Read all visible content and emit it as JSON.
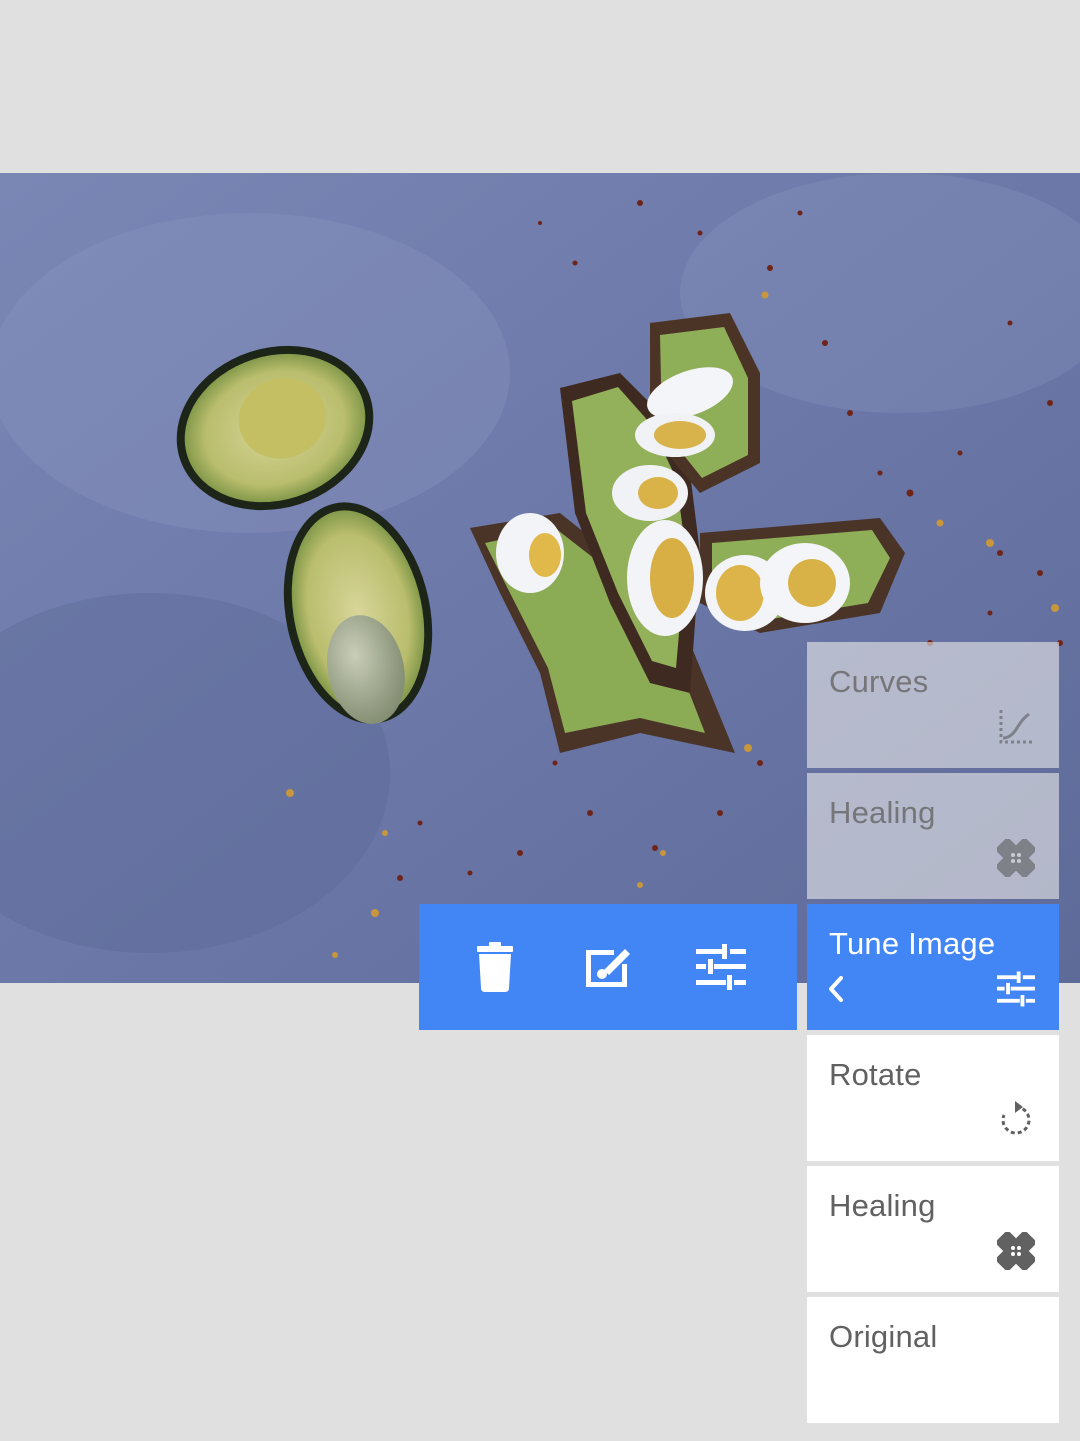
{
  "photo": {
    "subject": "avocado-toast-photo"
  },
  "toolbar": {
    "items": [
      {
        "name": "delete",
        "icon": "trash-icon"
      },
      {
        "name": "edit",
        "icon": "edit-brush-icon"
      },
      {
        "name": "tune",
        "icon": "sliders-icon"
      }
    ]
  },
  "history": {
    "cards": [
      {
        "label": "Curves",
        "icon": "curves-icon",
        "state": "faded"
      },
      {
        "label": "Healing",
        "icon": "bandage-icon",
        "state": "faded"
      },
      {
        "label": "Tune Image",
        "icon": "sliders-icon",
        "state": "selected"
      },
      {
        "label": "Rotate",
        "icon": "rotate-icon",
        "state": "normal"
      },
      {
        "label": "Healing",
        "icon": "bandage-icon",
        "state": "normal"
      },
      {
        "label": "Original",
        "icon": "",
        "state": "normal"
      }
    ]
  },
  "colors": {
    "accent": "#4285f4",
    "background": "#e0e0e0",
    "card": "#ffffff",
    "text": "#616161"
  }
}
